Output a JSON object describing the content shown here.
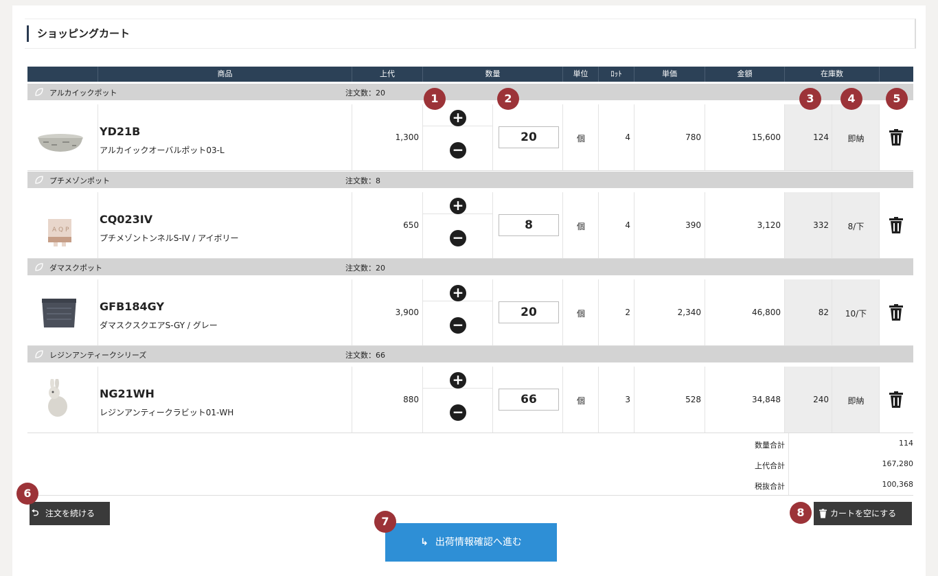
{
  "page_title": "ショッピングカート",
  "columns": {
    "product": "商品",
    "retail": "上代",
    "quantity": "数量",
    "unit": "単位",
    "lot": "ﾛｯﾄ",
    "unit_price": "単価",
    "amount": "金額",
    "stock": "在庫数"
  },
  "order_label": "注文数：",
  "groups": [
    {
      "name": "アルカイックポット",
      "order_count": "注文数：20",
      "code": "YD21B",
      "product_name": "アルカイックオーバルポット03-L",
      "retail": "1,300",
      "quantity": "20",
      "unit": "個",
      "lot": "4",
      "unit_price": "780",
      "amount": "15,600",
      "stock": "124",
      "delivery": "即納"
    },
    {
      "name": "プチメゾンポット",
      "order_count": "注文数：8",
      "code": "CQ023IV",
      "product_name": "プチメゾントンネルS-IV / アイボリー",
      "retail": "650",
      "quantity": "8",
      "unit": "個",
      "lot": "4",
      "unit_price": "390",
      "amount": "3,120",
      "stock": "332",
      "delivery": "8/下"
    },
    {
      "name": "ダマスクポット",
      "order_count": "注文数：20",
      "code": "GFB184GY",
      "product_name": "ダマスクスクエアS-GY / グレー",
      "retail": "3,900",
      "quantity": "20",
      "unit": "個",
      "lot": "2",
      "unit_price": "2,340",
      "amount": "46,800",
      "stock": "82",
      "delivery": "10/下"
    },
    {
      "name": "レジンアンティークシリーズ",
      "order_count": "注文数：66",
      "code": "NG21WH",
      "product_name": "レジンアンティークラビット01-WH",
      "retail": "880",
      "quantity": "66",
      "unit": "個",
      "lot": "3",
      "unit_price": "528",
      "amount": "34,848",
      "stock": "240",
      "delivery": "即納"
    }
  ],
  "totals": [
    {
      "label": "数量合計",
      "value": "114"
    },
    {
      "label": "上代合計",
      "value": "167,280"
    },
    {
      "label": "税抜合計",
      "value": "100,368"
    }
  ],
  "buttons": {
    "continue": "注文を続ける",
    "proceed": "出荷情報確認へ進む",
    "empty_cart": "カートを空にする"
  },
  "badges": [
    "1",
    "2",
    "3",
    "4",
    "5",
    "6",
    "7",
    "8"
  ],
  "colors": {
    "header_bg": "#2c4157",
    "badge": "#9c3338",
    "primary_button": "#2e8fd6",
    "dark_button": "#3a3a3a"
  }
}
